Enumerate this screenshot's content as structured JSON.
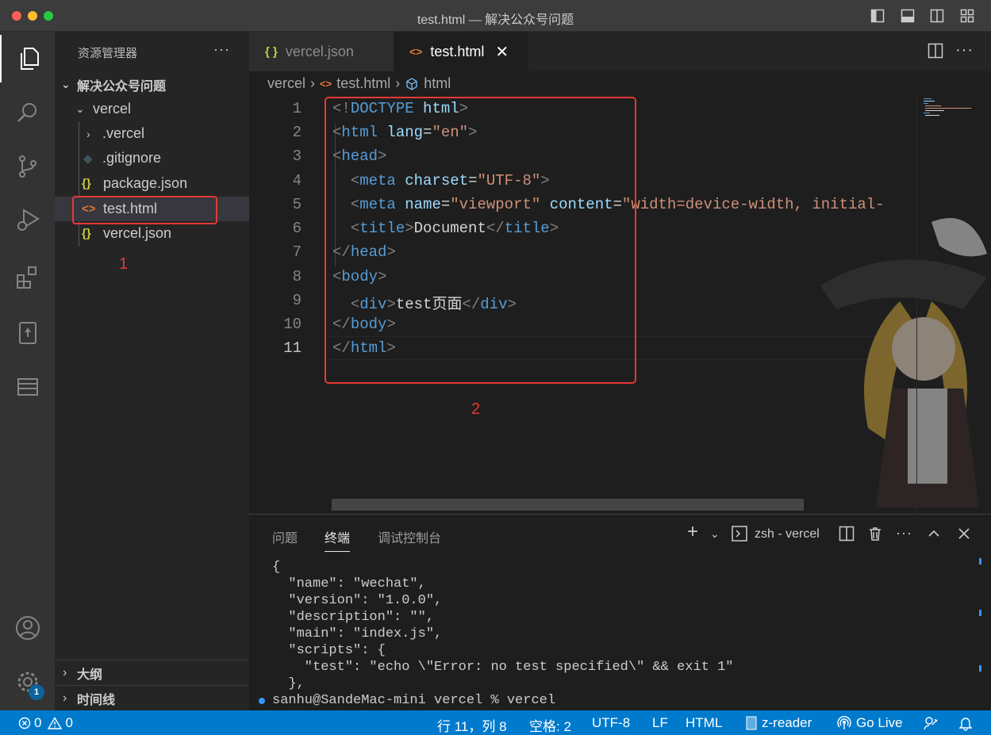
{
  "window": {
    "title": "test.html — 解决公众号问题"
  },
  "activity_bar": {
    "settings_badge": "1"
  },
  "sidebar": {
    "title": "资源管理器",
    "more": "···",
    "root_folder": "解决公众号问题",
    "items": [
      {
        "label": "vercel",
        "kind": "folder-open"
      },
      {
        "label": ".vercel",
        "kind": "folder"
      },
      {
        "label": ".gitignore",
        "kind": "git"
      },
      {
        "label": "package.json",
        "kind": "json"
      },
      {
        "label": "test.html",
        "kind": "html"
      },
      {
        "label": "vercel.json",
        "kind": "json"
      }
    ],
    "outline_label": "大纲",
    "timeline_label": "时间线"
  },
  "annotations": {
    "one": "1",
    "two": "2"
  },
  "tabs": [
    {
      "label": "vercel.json",
      "icon": "{ }",
      "active": false
    },
    {
      "label": "test.html",
      "icon": "<>",
      "active": true
    }
  ],
  "breadcrumb": {
    "folder": "vercel",
    "file": "test.html",
    "symbol": "html"
  },
  "editor": {
    "line_numbers": [
      "1",
      "2",
      "3",
      "4",
      "5",
      "6",
      "7",
      "8",
      "9",
      "10",
      "11"
    ],
    "current_line": "11"
  },
  "panel": {
    "tabs": {
      "problems": "问题",
      "terminal": "终端",
      "debug_console": "调试控制台"
    },
    "terminal_name": "zsh - vercel",
    "lines": [
      "{",
      "  \"name\": \"wechat\",",
      "  \"version\": \"1.0.0\",",
      "  \"description\": \"\",",
      "  \"main\": \"index.js\",",
      "  \"scripts\": {",
      "    \"test\": \"echo \\\"Error: no test specified\\\" && exit 1\"",
      "  },"
    ],
    "prompt": "sanhu@SandeMac-mini vercel % vercel"
  },
  "status_bar": {
    "errors": "0",
    "warnings": "0",
    "position": "行 11，列 8",
    "spaces": "空格: 2",
    "encoding": "UTF-8",
    "eol": "LF",
    "language": "HTML",
    "reader": "z-reader",
    "golive": "Go Live"
  },
  "colors": {
    "accent": "#007acc",
    "annotation": "#e53935",
    "html_icon": "#e37933",
    "json_icon": "#cbcb41"
  }
}
